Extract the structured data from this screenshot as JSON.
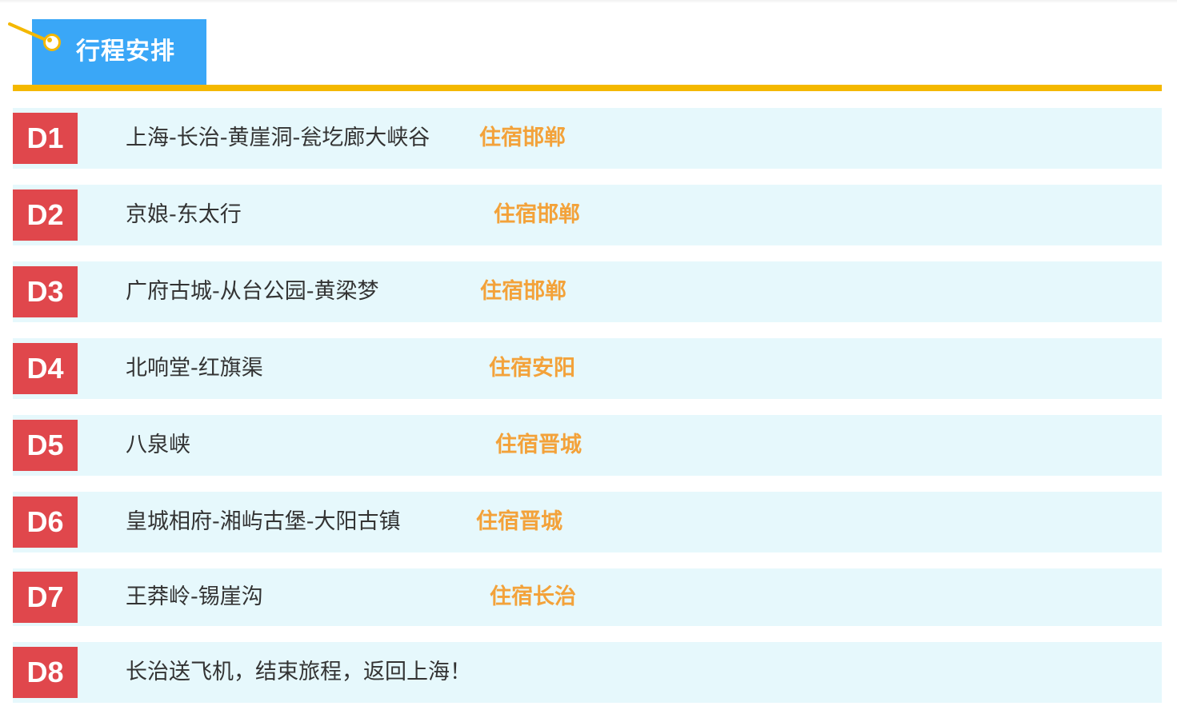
{
  "header": {
    "title": "行程安排",
    "icon": "pin-icon",
    "colors": {
      "tab": "#3aa7f7",
      "rule": "#f4b800",
      "pin": "#f4b800"
    }
  },
  "colors": {
    "badge": "#e0474c",
    "row_background": "#e6f8fc",
    "stay_text": "#f3a23a",
    "route_text": "#333333"
  },
  "days": [
    {
      "day": "D1",
      "route": "上海-长治-黄崖洞-瓮圪廊大峡谷",
      "stay": "住宿邯郸"
    },
    {
      "day": "D2",
      "route": "京娘-东太行",
      "stay": "住宿邯郸"
    },
    {
      "day": "D3",
      "route": "广府古城-从台公园-黄梁梦",
      "stay": "住宿邯郸"
    },
    {
      "day": "D4",
      "route": "北响堂-红旗渠",
      "stay": "住宿安阳"
    },
    {
      "day": "D5",
      "route": "八泉峡",
      "stay": "住宿晋城"
    },
    {
      "day": "D6",
      "route": "皇城相府-湘屿古堡-大阳古镇",
      "stay": "住宿晋城"
    },
    {
      "day": "D7",
      "route": "王莽岭-锡崖沟",
      "stay": "住宿长治"
    },
    {
      "day": "D8",
      "route": "长治送飞机，结束旅程，返回上海！",
      "stay": ""
    }
  ]
}
